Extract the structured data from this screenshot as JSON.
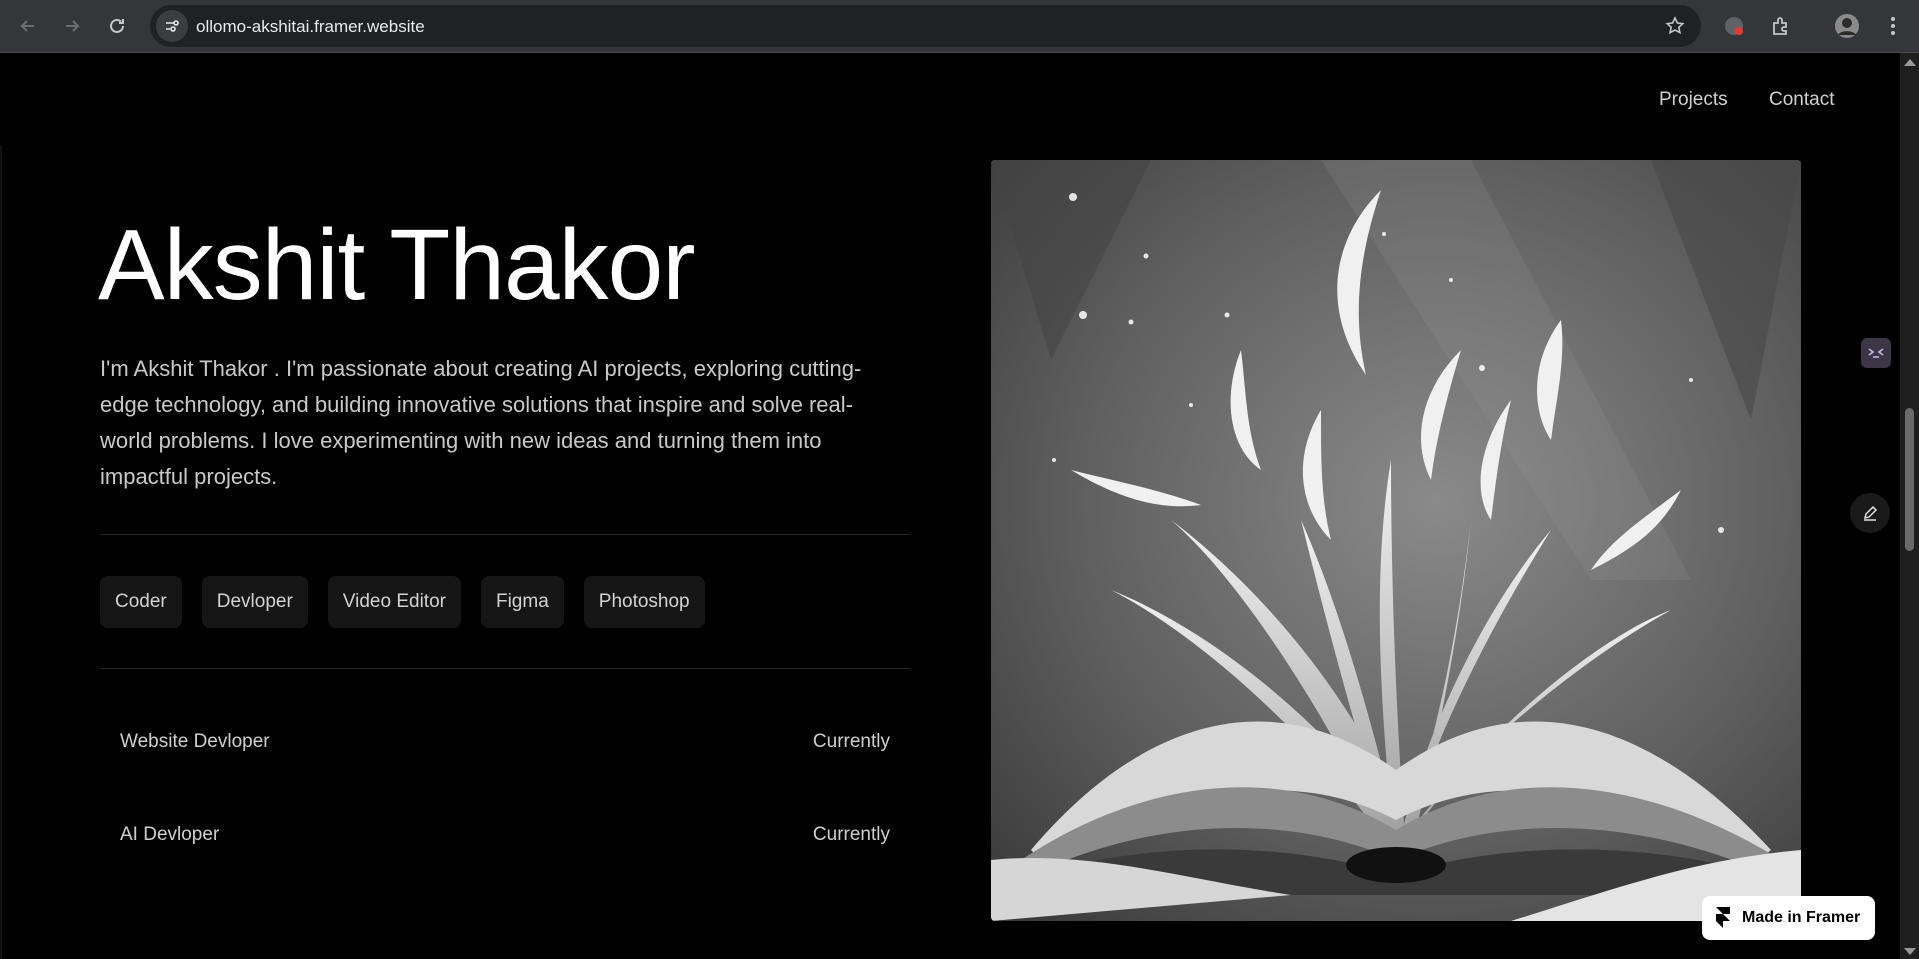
{
  "browser": {
    "url": "ollomo-akshitai.framer.website"
  },
  "nav": {
    "projects": "Projects",
    "contact": "Contact"
  },
  "hero": {
    "name": "Akshit Thakor",
    "bio": "I'm Akshit Thakor . I'm passionate about creating AI projects, exploring cutting-edge technology, and building innovative solutions that inspire and solve real-world problems. I love experimenting with new ideas and turning them into impactful projects."
  },
  "tags": [
    "Coder",
    "Devloper",
    "Video Editor",
    "Figma",
    "Photoshop"
  ],
  "experience": [
    {
      "role": "Website Devloper",
      "period": "Currently"
    },
    {
      "role": "AI Devloper",
      "period": "Currently"
    }
  ],
  "badge": {
    "label": "Made in Framer"
  }
}
